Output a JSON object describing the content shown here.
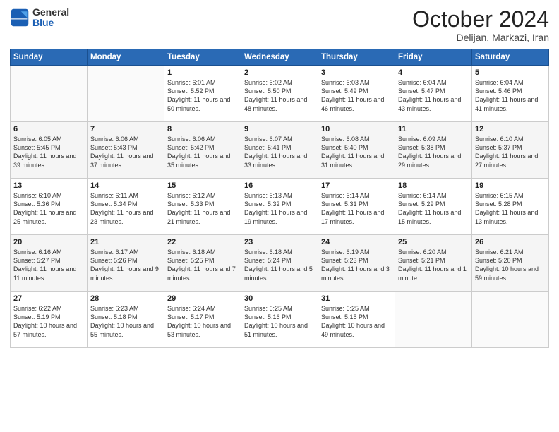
{
  "header": {
    "logo_general": "General",
    "logo_blue": "Blue",
    "month": "October 2024",
    "location": "Delijan, Markazi, Iran"
  },
  "days_of_week": [
    "Sunday",
    "Monday",
    "Tuesday",
    "Wednesday",
    "Thursday",
    "Friday",
    "Saturday"
  ],
  "weeks": [
    [
      {
        "day": "",
        "text": ""
      },
      {
        "day": "",
        "text": ""
      },
      {
        "day": "1",
        "text": "Sunrise: 6:01 AM\nSunset: 5:52 PM\nDaylight: 11 hours and 50 minutes."
      },
      {
        "day": "2",
        "text": "Sunrise: 6:02 AM\nSunset: 5:50 PM\nDaylight: 11 hours and 48 minutes."
      },
      {
        "day": "3",
        "text": "Sunrise: 6:03 AM\nSunset: 5:49 PM\nDaylight: 11 hours and 46 minutes."
      },
      {
        "day": "4",
        "text": "Sunrise: 6:04 AM\nSunset: 5:47 PM\nDaylight: 11 hours and 43 minutes."
      },
      {
        "day": "5",
        "text": "Sunrise: 6:04 AM\nSunset: 5:46 PM\nDaylight: 11 hours and 41 minutes."
      }
    ],
    [
      {
        "day": "6",
        "text": "Sunrise: 6:05 AM\nSunset: 5:45 PM\nDaylight: 11 hours and 39 minutes."
      },
      {
        "day": "7",
        "text": "Sunrise: 6:06 AM\nSunset: 5:43 PM\nDaylight: 11 hours and 37 minutes."
      },
      {
        "day": "8",
        "text": "Sunrise: 6:06 AM\nSunset: 5:42 PM\nDaylight: 11 hours and 35 minutes."
      },
      {
        "day": "9",
        "text": "Sunrise: 6:07 AM\nSunset: 5:41 PM\nDaylight: 11 hours and 33 minutes."
      },
      {
        "day": "10",
        "text": "Sunrise: 6:08 AM\nSunset: 5:40 PM\nDaylight: 11 hours and 31 minutes."
      },
      {
        "day": "11",
        "text": "Sunrise: 6:09 AM\nSunset: 5:38 PM\nDaylight: 11 hours and 29 minutes."
      },
      {
        "day": "12",
        "text": "Sunrise: 6:10 AM\nSunset: 5:37 PM\nDaylight: 11 hours and 27 minutes."
      }
    ],
    [
      {
        "day": "13",
        "text": "Sunrise: 6:10 AM\nSunset: 5:36 PM\nDaylight: 11 hours and 25 minutes."
      },
      {
        "day": "14",
        "text": "Sunrise: 6:11 AM\nSunset: 5:34 PM\nDaylight: 11 hours and 23 minutes."
      },
      {
        "day": "15",
        "text": "Sunrise: 6:12 AM\nSunset: 5:33 PM\nDaylight: 11 hours and 21 minutes."
      },
      {
        "day": "16",
        "text": "Sunrise: 6:13 AM\nSunset: 5:32 PM\nDaylight: 11 hours and 19 minutes."
      },
      {
        "day": "17",
        "text": "Sunrise: 6:14 AM\nSunset: 5:31 PM\nDaylight: 11 hours and 17 minutes."
      },
      {
        "day": "18",
        "text": "Sunrise: 6:14 AM\nSunset: 5:29 PM\nDaylight: 11 hours and 15 minutes."
      },
      {
        "day": "19",
        "text": "Sunrise: 6:15 AM\nSunset: 5:28 PM\nDaylight: 11 hours and 13 minutes."
      }
    ],
    [
      {
        "day": "20",
        "text": "Sunrise: 6:16 AM\nSunset: 5:27 PM\nDaylight: 11 hours and 11 minutes."
      },
      {
        "day": "21",
        "text": "Sunrise: 6:17 AM\nSunset: 5:26 PM\nDaylight: 11 hours and 9 minutes."
      },
      {
        "day": "22",
        "text": "Sunrise: 6:18 AM\nSunset: 5:25 PM\nDaylight: 11 hours and 7 minutes."
      },
      {
        "day": "23",
        "text": "Sunrise: 6:18 AM\nSunset: 5:24 PM\nDaylight: 11 hours and 5 minutes."
      },
      {
        "day": "24",
        "text": "Sunrise: 6:19 AM\nSunset: 5:23 PM\nDaylight: 11 hours and 3 minutes."
      },
      {
        "day": "25",
        "text": "Sunrise: 6:20 AM\nSunset: 5:21 PM\nDaylight: 11 hours and 1 minute."
      },
      {
        "day": "26",
        "text": "Sunrise: 6:21 AM\nSunset: 5:20 PM\nDaylight: 10 hours and 59 minutes."
      }
    ],
    [
      {
        "day": "27",
        "text": "Sunrise: 6:22 AM\nSunset: 5:19 PM\nDaylight: 10 hours and 57 minutes."
      },
      {
        "day": "28",
        "text": "Sunrise: 6:23 AM\nSunset: 5:18 PM\nDaylight: 10 hours and 55 minutes."
      },
      {
        "day": "29",
        "text": "Sunrise: 6:24 AM\nSunset: 5:17 PM\nDaylight: 10 hours and 53 minutes."
      },
      {
        "day": "30",
        "text": "Sunrise: 6:25 AM\nSunset: 5:16 PM\nDaylight: 10 hours and 51 minutes."
      },
      {
        "day": "31",
        "text": "Sunrise: 6:25 AM\nSunset: 5:15 PM\nDaylight: 10 hours and 49 minutes."
      },
      {
        "day": "",
        "text": ""
      },
      {
        "day": "",
        "text": ""
      }
    ]
  ]
}
